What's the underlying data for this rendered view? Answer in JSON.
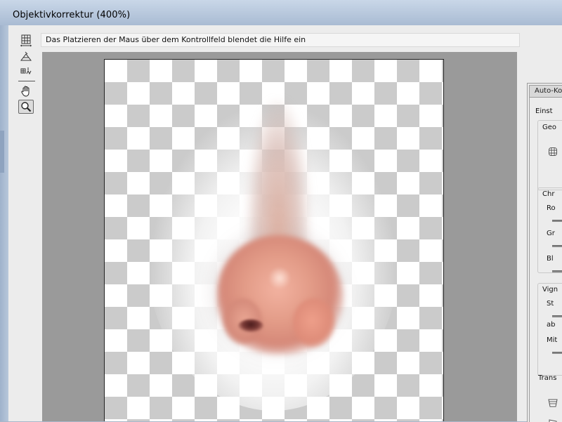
{
  "window": {
    "title": "Objektivkorrektur (400%)"
  },
  "toolbar": {
    "tools": [
      {
        "icon": "grid-align-icon",
        "label": ""
      },
      {
        "icon": "straighten-icon",
        "label": ""
      },
      {
        "icon": "move-grid-icon",
        "label": ""
      },
      {
        "icon": "hand-icon",
        "label": ""
      },
      {
        "icon": "zoom-icon",
        "label": ""
      }
    ],
    "selected_tool": "zoom-icon"
  },
  "help": {
    "text": "Das Platzieren der Maus über dem Kontrollfeld blendet die Hilfe ein"
  },
  "panel": {
    "tab": "Auto-Ko",
    "section1": "Einst",
    "geo_label": "Geo",
    "chrom_label": "Chr",
    "rot_label": "Ro",
    "gruen_label": "Gr",
    "blau_label": "Bl",
    "vign_label": "Vign",
    "staerke_label": "St",
    "ab_label": "ab",
    "mitte_label": "Mit",
    "trans_label": "Trans"
  },
  "colors": {
    "titlebar": "#b8c8dc",
    "background": "#ececec",
    "checker": "#cbcbcb"
  }
}
